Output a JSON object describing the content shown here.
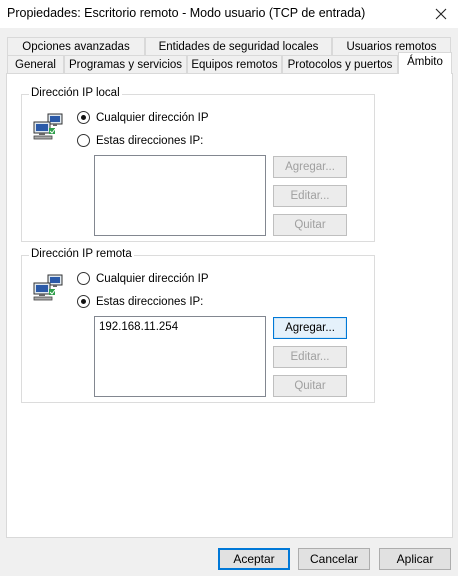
{
  "window": {
    "title": "Propiedades: Escritorio remoto - Modo usuario (TCP de entrada)",
    "close_icon": "close-icon"
  },
  "tabs_row1": [
    {
      "label": "Opciones avanzadas"
    },
    {
      "label": "Entidades de seguridad locales"
    },
    {
      "label": "Usuarios remotos"
    }
  ],
  "tabs_row2": [
    {
      "label": "General"
    },
    {
      "label": "Programas y servicios"
    },
    {
      "label": "Equipos remotos"
    },
    {
      "label": "Protocolos y puertos"
    },
    {
      "label": "Ámbito",
      "active": true
    }
  ],
  "local_group": {
    "title": "Dirección IP local",
    "icon": "network-computers-icon",
    "radio_any": "Cualquier dirección IP",
    "radio_these": "Estas direcciones IP:",
    "selected": "any",
    "addresses": [],
    "buttons": {
      "add": "Agregar...",
      "edit": "Editar...",
      "remove": "Quitar"
    }
  },
  "remote_group": {
    "title": "Dirección IP remota",
    "icon": "network-computers-icon",
    "radio_any": "Cualquier dirección IP",
    "radio_these": "Estas direcciones IP:",
    "selected": "these",
    "addresses": [
      "192.168.11.254"
    ],
    "buttons": {
      "add": "Agregar...",
      "edit": "Editar...",
      "remove": "Quitar"
    }
  },
  "footer": {
    "ok": "Aceptar",
    "cancel": "Cancelar",
    "apply": "Aplicar"
  },
  "colors": {
    "accent": "#0078d7",
    "disabled_text": "#a0a0a0",
    "dialog_bg": "#f0f0f0"
  }
}
